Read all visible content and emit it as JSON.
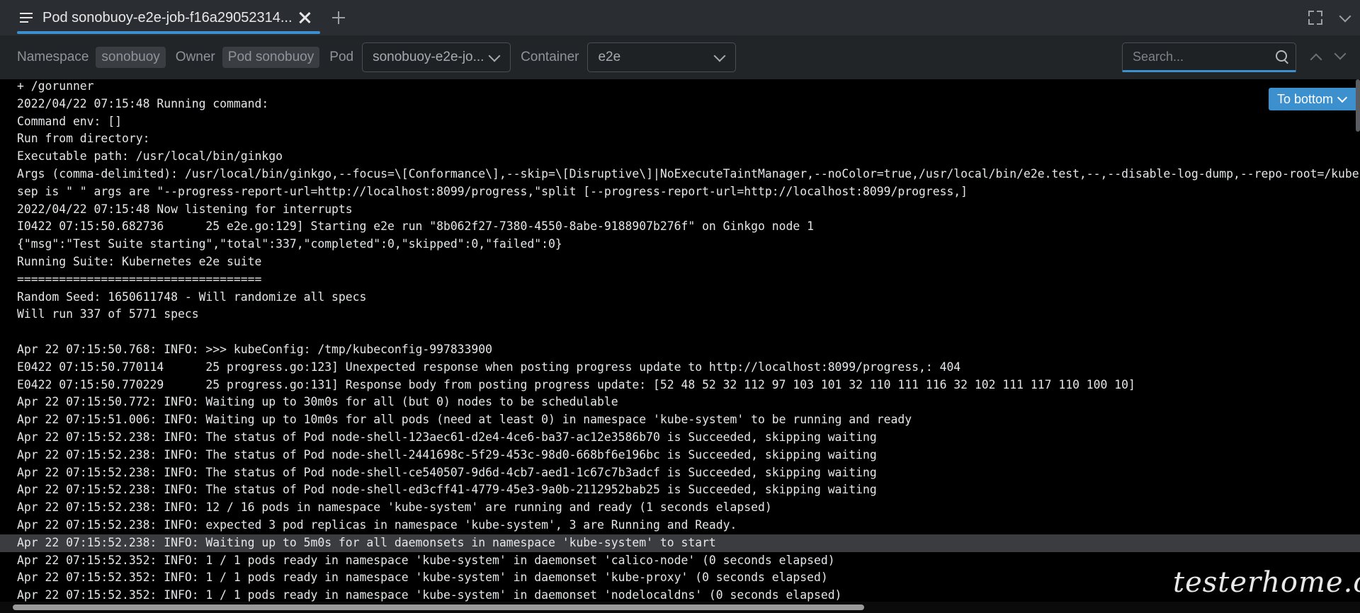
{
  "tab": {
    "title": "Pod sonobuoy-e2e-job-f16a29052314..."
  },
  "toolbar": {
    "namespace_label": "Namespace",
    "namespace_value": "sonobuoy",
    "owner_label": "Owner",
    "owner_value": "Pod sonobuoy",
    "pod_label": "Pod",
    "pod_value": "sonobuoy-e2e-jo...",
    "container_label": "Container",
    "container_value": "e2e",
    "search_placeholder": "Search..."
  },
  "to_bottom_label": "To bottom",
  "watermark": "testerhome.com",
  "log_lines": [
    "+ /gorunner",
    "2022/04/22 07:15:48 Running command:",
    "Command env: []",
    "Run from directory:",
    "Executable path: /usr/local/bin/ginkgo",
    "Args (comma-delimited): /usr/local/bin/ginkgo,--focus=\\[Conformance\\],--skip=\\[Disruptive\\]|NoExecuteTaintManager,--noColor=true,/usr/local/bin/e2e.test,--,--disable-log-dump,--repo-root=/kubernetes",
    "sep is \" \" args are \"--progress-report-url=http://localhost:8099/progress,\"split [--progress-report-url=http://localhost:8099/progress,]",
    "2022/04/22 07:15:48 Now listening for interrupts",
    "I0422 07:15:50.682736      25 e2e.go:129] Starting e2e run \"8b062f27-7380-4550-8abe-9188907b276f\" on Ginkgo node 1",
    "{\"msg\":\"Test Suite starting\",\"total\":337,\"completed\":0,\"skipped\":0,\"failed\":0}",
    "Running Suite: Kubernetes e2e suite",
    "===================================",
    "Random Seed: 1650611748 - Will randomize all specs",
    "Will run 337 of 5771 specs",
    "",
    "Apr 22 07:15:50.768: INFO: >>> kubeConfig: /tmp/kubeconfig-997833900",
    "E0422 07:15:50.770114      25 progress.go:123] Unexpected response when posting progress update to http://localhost:8099/progress,: 404",
    "E0422 07:15:50.770229      25 progress.go:131] Response body from posting progress update: [52 48 52 32 112 97 103 101 32 110 111 116 32 102 111 117 110 100 10]",
    "Apr 22 07:15:50.772: INFO: Waiting up to 30m0s for all (but 0) nodes to be schedulable",
    "Apr 22 07:15:51.006: INFO: Waiting up to 10m0s for all pods (need at least 0) in namespace 'kube-system' to be running and ready",
    "Apr 22 07:15:52.238: INFO: The status of Pod node-shell-123aec61-d2e4-4ce6-ba37-ac12e3586b70 is Succeeded, skipping waiting",
    "Apr 22 07:15:52.238: INFO: The status of Pod node-shell-2441698c-5f29-453c-98d0-668bf6e196bc is Succeeded, skipping waiting",
    "Apr 22 07:15:52.238: INFO: The status of Pod node-shell-ce540507-9d6d-4cb7-aed1-1c67c7b3adcf is Succeeded, skipping waiting",
    "Apr 22 07:15:52.238: INFO: The status of Pod node-shell-ed3cff41-4779-45e3-9a0b-2112952bab25 is Succeeded, skipping waiting",
    "Apr 22 07:15:52.238: INFO: 12 / 16 pods in namespace 'kube-system' are running and ready (1 seconds elapsed)",
    "Apr 22 07:15:52.238: INFO: expected 3 pod replicas in namespace 'kube-system', 3 are Running and Ready.",
    "Apr 22 07:15:52.238: INFO: Waiting up to 5m0s for all daemonsets in namespace 'kube-system' to start",
    "Apr 22 07:15:52.352: INFO: 1 / 1 pods ready in namespace 'kube-system' in daemonset 'calico-node' (0 seconds elapsed)",
    "Apr 22 07:15:52.352: INFO: 1 / 1 pods ready in namespace 'kube-system' in daemonset 'kube-proxy' (0 seconds elapsed)",
    "Apr 22 07:15:52.352: INFO: 1 / 1 pods ready in namespace 'kube-system' in daemonset 'nodelocaldns' (0 seconds elapsed)"
  ],
  "highlighted_line": 26
}
